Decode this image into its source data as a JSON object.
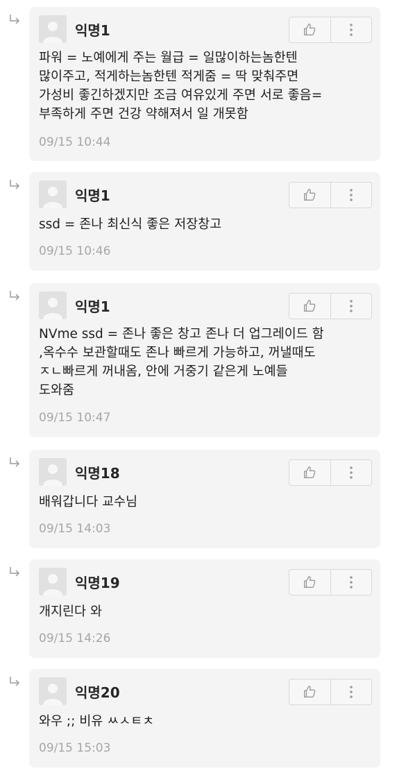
{
  "comments": [
    {
      "author": "익명1",
      "text": "파워 = 노예에게 주는 월급 = 일많이하는놈한텐\n많이주고, 적게하는놈한텐 적게줌 = 딱 맞춰주면\n가성비 좋긴하겠지만 조금 여유있게 주면 서로 좋음=\n부족하게 주면 건강 약해져서 일 개못함",
      "time": "09/15 10:44"
    },
    {
      "author": "익명1",
      "text": "ssd = 존나 최신식 좋은 저장창고",
      "time": "09/15 10:46"
    },
    {
      "author": "익명1",
      "text": "NVme ssd = 존나 좋은 창고 존나 더 업그레이드 함\n,옥수수 보관할때도 존나 빠르게 가능하고, 꺼낼때도\nㅈㄴ빠르게 꺼내옴, 안에 거중기 같은게 노예들\n도와줌",
      "time": "09/15 10:47"
    },
    {
      "author": "익명18",
      "text": "배워갑니다 교수님",
      "time": "09/15 14:03"
    },
    {
      "author": "익명19",
      "text": "개지린다 와",
      "time": "09/15 14:26"
    },
    {
      "author": "익명20",
      "text": "와우 ;; 비유 ㅆㅅㅌㅊ",
      "time": "09/15 15:03"
    }
  ],
  "icons": {
    "reply_arrow": "reply-arrow-icon",
    "avatar": "default-avatar-icon",
    "like": "thumbs-up-icon",
    "more": "more-vertical-icon"
  },
  "colors": {
    "card_background": "#f4f4f4",
    "timestamp": "#a6a6a6",
    "icon": "#9a9a9a"
  }
}
